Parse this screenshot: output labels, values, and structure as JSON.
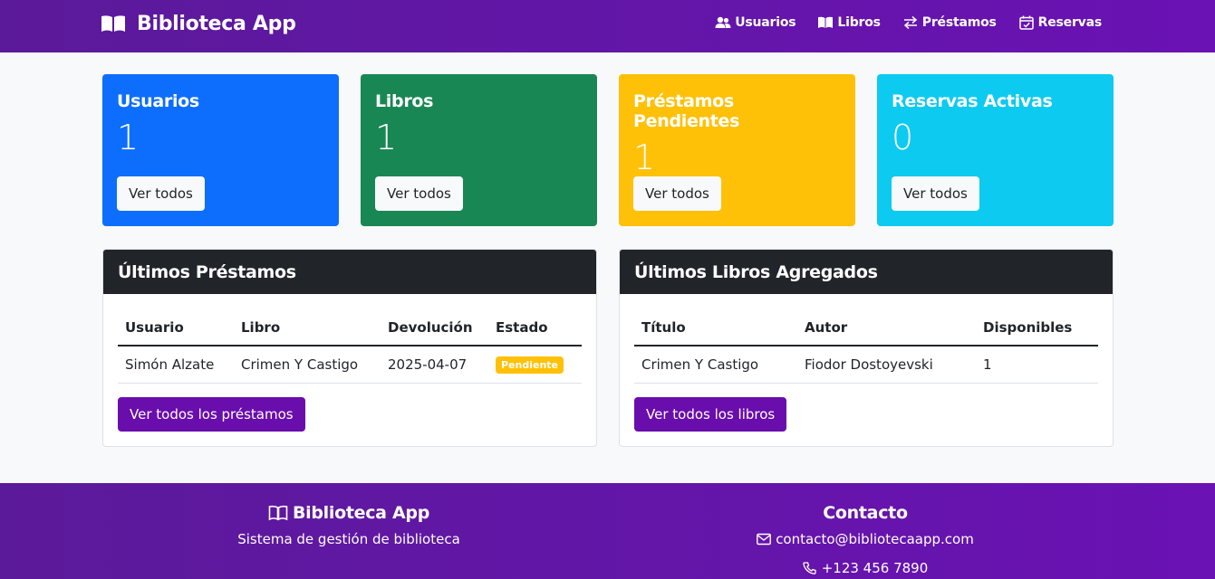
{
  "navbar": {
    "brand": "Biblioteca App",
    "items": [
      {
        "label": "Usuarios",
        "icon": "people-icon"
      },
      {
        "label": "Libros",
        "icon": "book-icon"
      },
      {
        "label": "Préstamos",
        "icon": "exchange-arrows-icon"
      },
      {
        "label": "Reservas",
        "icon": "calendar-check-icon"
      }
    ]
  },
  "stats": [
    {
      "title": "Usuarios",
      "value": "1",
      "button": "Ver todos",
      "color": "#0d6efd"
    },
    {
      "title": "Libros",
      "value": "1",
      "button": "Ver todos",
      "color": "#198754"
    },
    {
      "title": "Préstamos Pendientes",
      "value": "1",
      "button": "Ver todos",
      "color": "#ffc107"
    },
    {
      "title": "Reservas Activas",
      "value": "0",
      "button": "Ver todos",
      "color": "#0dcaf0"
    }
  ],
  "loans": {
    "title": "Últimos Préstamos",
    "columns": [
      "Usuario",
      "Libro",
      "Devolución",
      "Estado"
    ],
    "rows": [
      {
        "usuario": "Simón Alzate",
        "libro": "Crimen Y Castigo",
        "devolucion": "2025-04-07",
        "estado": "Pendiente"
      }
    ],
    "button": "Ver todos los préstamos"
  },
  "books": {
    "title": "Últimos Libros Agregados",
    "columns": [
      "Título",
      "Autor",
      "Disponibles"
    ],
    "rows": [
      {
        "titulo": "Crimen Y Castigo",
        "autor": "Fiodor Dostoyevski",
        "disponibles": "1"
      }
    ],
    "button": "Ver todos los libros"
  },
  "footer": {
    "brand": "Biblioteca App",
    "tagline": "Sistema de gestión de biblioteca",
    "contact_title": "Contacto",
    "email": "contacto@bibliotecaapp.com",
    "phone": "+123 456 7890"
  },
  "colors": {
    "primary_purple": "#6a0dad",
    "dark_header": "#212529",
    "badge_warning": "#ffc107"
  }
}
